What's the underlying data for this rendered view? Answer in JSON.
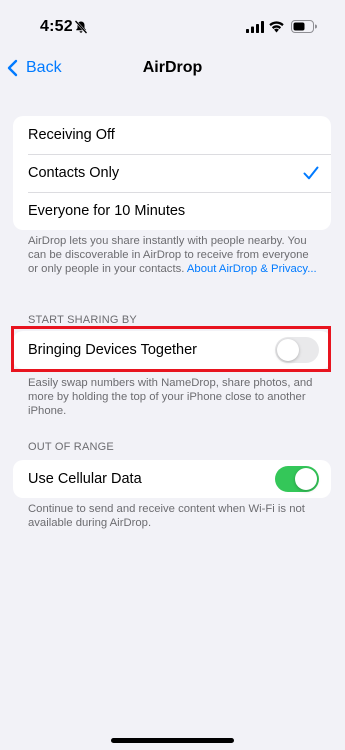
{
  "status_bar": {
    "time": "4:52",
    "icons": [
      "bell-slash-icon",
      "cellular-signal-icon",
      "wifi-icon",
      "battery-icon"
    ]
  },
  "nav": {
    "back_label": "Back",
    "title": "AirDrop"
  },
  "receiving": {
    "options": [
      {
        "label": "Receiving Off",
        "selected": false
      },
      {
        "label": "Contacts Only",
        "selected": true
      },
      {
        "label": "Everyone for 10 Minutes",
        "selected": false
      }
    ],
    "footer": "AirDrop lets you share instantly with people nearby. You can be discoverable in AirDrop to receive from everyone or only people in your contacts.",
    "footer_link": "About AirDrop & Privacy..."
  },
  "start_sharing": {
    "header": "START SHARING BY",
    "toggle_label": "Bringing Devices Together",
    "toggle_on": false,
    "footer": "Easily swap numbers with NameDrop, share photos, and more by holding the top of your iPhone close to another iPhone."
  },
  "out_of_range": {
    "header": "OUT OF RANGE",
    "toggle_label": "Use Cellular Data",
    "toggle_on": true,
    "footer": "Continue to send and receive content when Wi-Fi is not available during AirDrop."
  },
  "colors": {
    "accent": "#007aff",
    "toggle_on": "#34c759",
    "highlight": "#e8141f",
    "background": "#f2f2f7"
  }
}
